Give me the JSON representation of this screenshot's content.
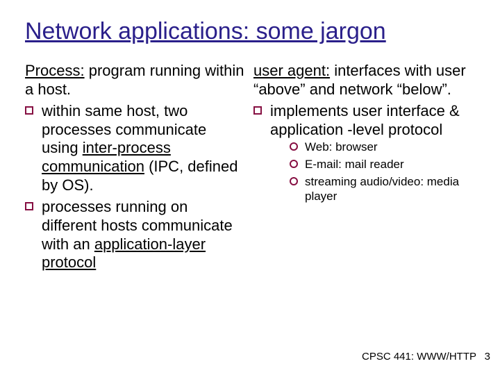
{
  "title": "Network applications: some jargon",
  "left": {
    "lead_term": "Process:",
    "lead_rest": " program running within a host.",
    "bullets": [
      {
        "pre": "within same host, two processes communicate using  ",
        "underline": "inter-process communication",
        "post": " (IPC, defined by OS)."
      },
      {
        "pre": "processes running on different hosts communicate with an ",
        "underline": "application-layer protocol",
        "post": ""
      }
    ]
  },
  "right": {
    "lead_term": "user agent:",
    "lead_rest": " interfaces with user “above” and network “below”.",
    "bullets": [
      {
        "pre": "implements user interface & application -level protocol",
        "underline": "",
        "post": ""
      }
    ],
    "sub": [
      "Web: browser",
      "E-mail: mail reader",
      "streaming audio/video: media player"
    ]
  },
  "footer": "CPSC 441: WWW/HTTP",
  "page": "3"
}
